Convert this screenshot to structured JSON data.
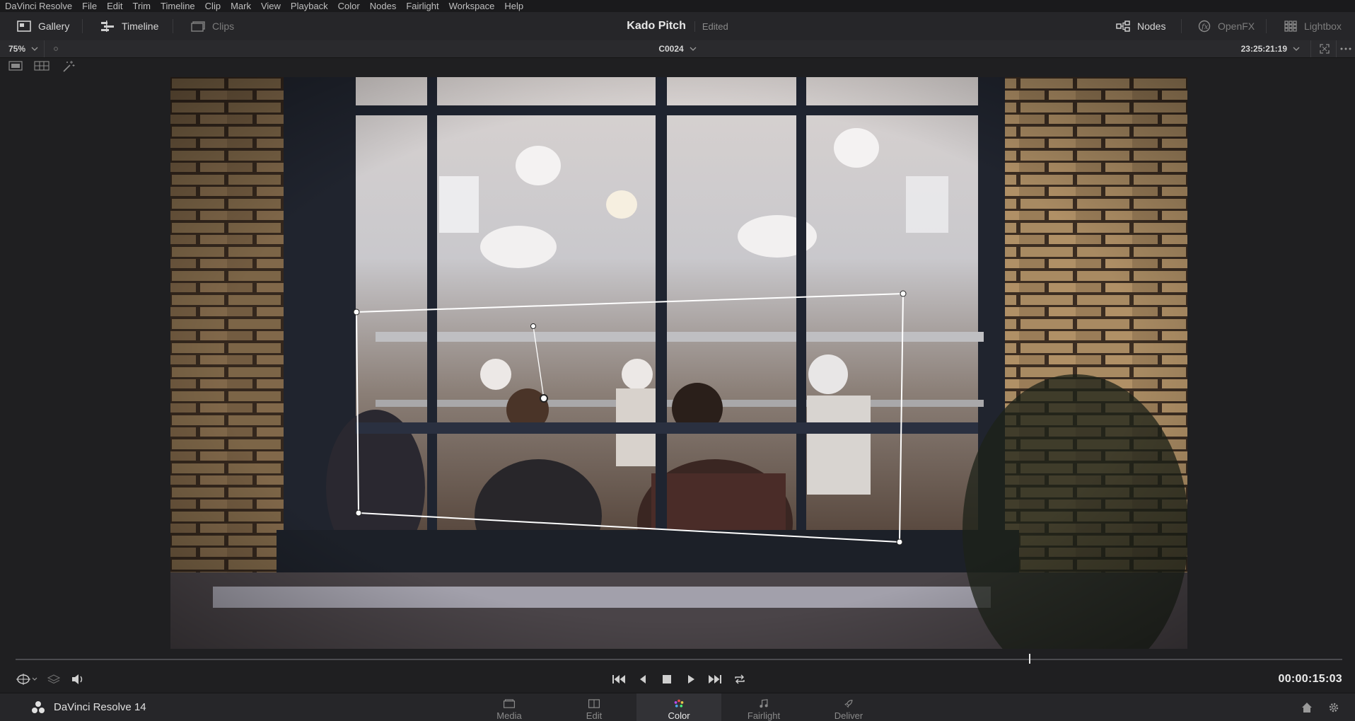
{
  "menu": [
    "DaVinci Resolve",
    "File",
    "Edit",
    "Trim",
    "Timeline",
    "Clip",
    "Mark",
    "View",
    "Playback",
    "Color",
    "Nodes",
    "Fairlight",
    "Workspace",
    "Help"
  ],
  "toolbar": {
    "gallery": "Gallery",
    "timeline": "Timeline",
    "clips": "Clips",
    "project_name": "Kado Pitch",
    "project_status": "Edited",
    "nodes": "Nodes",
    "openfx": "OpenFX",
    "lightbox": "Lightbox"
  },
  "viewer": {
    "zoom": "75%",
    "clip": "C0024",
    "timecode": "23:25:21:19"
  },
  "playhead_fraction": 0.764,
  "transport": {
    "timecode": "00:00:15:03"
  },
  "pagebar": {
    "brand": "DaVinci Resolve 14",
    "pages": [
      "Media",
      "Edit",
      "Color",
      "Fairlight",
      "Deliver"
    ],
    "active_page": "Color"
  },
  "colors": {
    "background": "#1f1f21",
    "toolbar": "#262629",
    "accent_active": "#323236"
  }
}
